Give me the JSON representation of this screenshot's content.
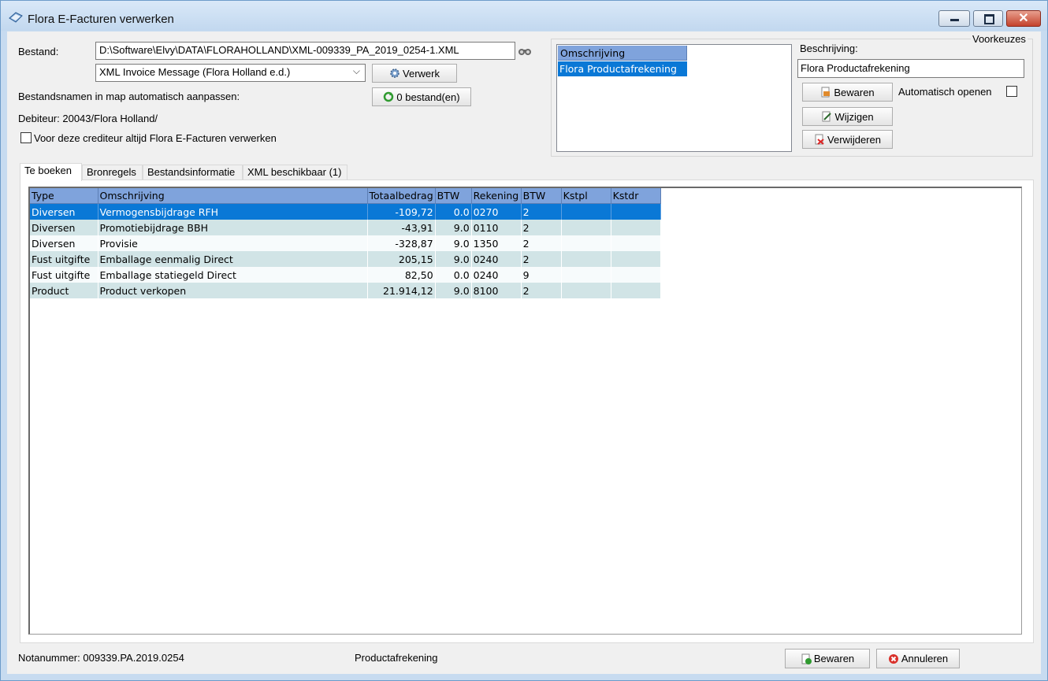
{
  "window": {
    "title": "Flora E-Facturen verwerken"
  },
  "file": {
    "label": "Bestand:",
    "path": "D:\\Software\\Elvy\\DATA\\FLORAHOLLAND\\XML-009339_PA_2019_0254-1.XML",
    "format_value": "XML Invoice Message (Flora Holland e.d.)",
    "process_label": "Verwerk",
    "rename_label": "Bestandsnamen in map automatisch aanpassen:",
    "files_button": "0 bestand(en)",
    "debtor": "Debiteur: 20043/Flora Holland/",
    "always_label": "Voor deze crediteur altijd Flora E-Facturen verwerken"
  },
  "presets": {
    "title": "Voorkeuzes",
    "list_header": "Omschrijving",
    "items": [
      "Flora Productafrekening"
    ],
    "description_label": "Beschrijving:",
    "description_value": "Flora Productafrekening",
    "save_label": "Bewaren",
    "auto_open_label": "Automatisch openen",
    "edit_label": "Wijzigen",
    "delete_label": "Verwijderen"
  },
  "tabs": [
    "Te boeken",
    "Bronregels",
    "Bestandsinformatie",
    "XML beschikbaar (1)"
  ],
  "table": {
    "columns": [
      "Type",
      "Omschrijving",
      "Totaalbedrag",
      "BTW",
      "Rekening",
      "BTW",
      "Kstpl",
      "Kstdr"
    ],
    "rows": [
      [
        "Diversen",
        "Vermogensbijdrage RFH",
        "-109,72",
        "0.0",
        "0270",
        "2",
        "",
        ""
      ],
      [
        "Diversen",
        "Promotiebijdrage BBH",
        "-43,91",
        "9.0",
        "0110",
        "2",
        "",
        ""
      ],
      [
        "Diversen",
        "Provisie",
        "-328,87",
        "9.0",
        "1350",
        "2",
        "",
        ""
      ],
      [
        "Fust uitgifte",
        "Emballage eenmalig Direct",
        "205,15",
        "9.0",
        "0240",
        "2",
        "",
        ""
      ],
      [
        "Fust uitgifte",
        "Emballage statiegeld Direct",
        "82,50",
        "0.0",
        "0240",
        "9",
        "",
        ""
      ],
      [
        "Product",
        "Product verkopen",
        "21.914,12",
        "9.0",
        "8100",
        "2",
        "",
        ""
      ]
    ]
  },
  "footer": {
    "invoice_number": "Notanummer: 009339.PA.2019.0254",
    "type": "Productafrekening",
    "save_label": "Bewaren",
    "cancel_label": "Annuleren"
  }
}
